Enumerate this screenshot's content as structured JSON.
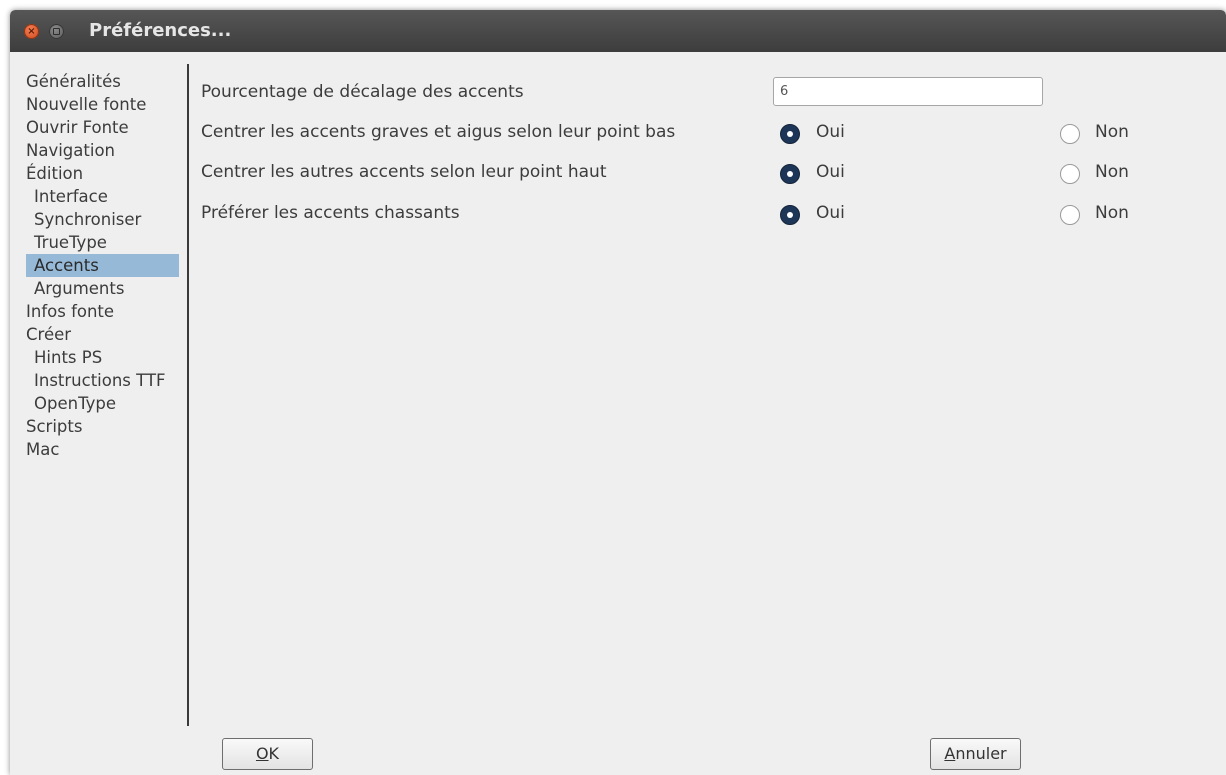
{
  "window": {
    "title": "Préférences..."
  },
  "sidebar": {
    "items": [
      {
        "label": "Généralités",
        "indent": false,
        "selected": false
      },
      {
        "label": "Nouvelle fonte",
        "indent": false,
        "selected": false
      },
      {
        "label": "Ouvrir Fonte",
        "indent": false,
        "selected": false
      },
      {
        "label": "Navigation",
        "indent": false,
        "selected": false
      },
      {
        "label": "Édition",
        "indent": false,
        "selected": false
      },
      {
        "label": "Interface",
        "indent": true,
        "selected": false
      },
      {
        "label": "Synchroniser",
        "indent": true,
        "selected": false
      },
      {
        "label": "TrueType",
        "indent": true,
        "selected": false
      },
      {
        "label": "Accents",
        "indent": true,
        "selected": true
      },
      {
        "label": "Arguments",
        "indent": true,
        "selected": false
      },
      {
        "label": "Infos fonte",
        "indent": false,
        "selected": false
      },
      {
        "label": "Créer",
        "indent": false,
        "selected": false
      },
      {
        "label": "Hints PS",
        "indent": true,
        "selected": false
      },
      {
        "label": "Instructions TTF",
        "indent": true,
        "selected": false
      },
      {
        "label": "OpenType",
        "indent": true,
        "selected": false
      },
      {
        "label": "Scripts",
        "indent": false,
        "selected": false
      },
      {
        "label": "Mac",
        "indent": false,
        "selected": false
      }
    ]
  },
  "main": {
    "offset": {
      "label": "Pourcentage de décalage des accents",
      "value": "6"
    },
    "options": [
      {
        "label": "Centrer les accents graves et aigus selon leur point bas",
        "yes_label": "Oui",
        "no_label": "Non",
        "selected": "yes"
      },
      {
        "label": "Centrer les autres accents selon leur point haut",
        "yes_label": "Oui",
        "no_label": "Non",
        "selected": "yes"
      },
      {
        "label": "Préférer les accents chassants",
        "yes_label": "Oui",
        "no_label": "Non",
        "selected": "yes"
      }
    ]
  },
  "footer": {
    "ok": {
      "mnemonic": "O",
      "rest": "K"
    },
    "cancel": {
      "mnemonic": "A",
      "rest": "nnuler"
    }
  },
  "colors": {
    "selection": "#96b9d7",
    "radio_selected": "#1d3557",
    "titlebar": "#3d3d3d",
    "close_button": "#e25a2c"
  },
  "icons": {
    "close": "close-icon",
    "minimize": "minimize-icon"
  }
}
